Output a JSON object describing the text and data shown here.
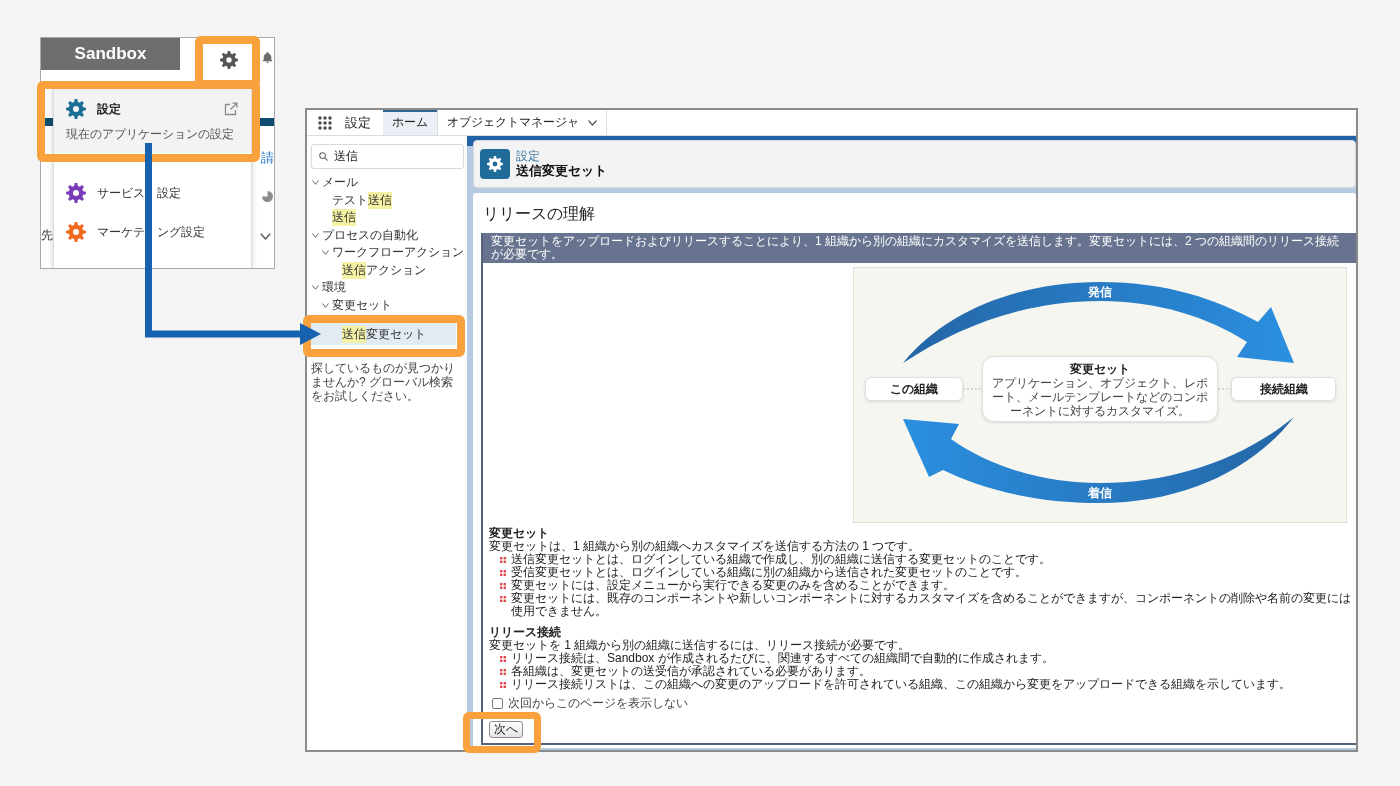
{
  "popup": {
    "sandbox_label": "Sandbox",
    "menu_items": [
      {
        "label_parts": [
          "設定"
        ],
        "subtitle": "現在のアプリケーションの設定",
        "external_link": true,
        "selected": true,
        "color": "#1b6d93"
      },
      {
        "label_parts": [
          "サービス",
          "設定"
        ],
        "external_link": false,
        "selected": false,
        "color": "#7a3bb8"
      },
      {
        "label_parts": [
          "マーケテ",
          "ング設定"
        ],
        "external_link": false,
        "selected": false,
        "color": "#f0691f"
      }
    ],
    "page_behind": {
      "link_fragment": "請",
      "label_fragment": "先"
    }
  },
  "main_window": {
    "app_name": "設定",
    "tabs": [
      {
        "label": "ホーム",
        "selected": true,
        "has_menu": false
      },
      {
        "label": "オブジェクトマネージャ",
        "selected": false,
        "has_menu": true
      }
    ],
    "sidebar": {
      "search": {
        "value": "送信"
      },
      "tree": [
        {
          "segments": [
            {
              "text": "メール",
              "highlight": false
            }
          ],
          "selected": false,
          "expanded": true,
          "children": [
            {
              "segments": [
                {
                  "text": "テスト",
                  "highlight": false
                },
                {
                  "text": "送信",
                  "highlight": true
                }
              ],
              "selected": false
            },
            {
              "segments": [
                {
                  "text": "送信",
                  "highlight": true
                }
              ],
              "selected": false
            }
          ]
        },
        {
          "segments": [
            {
              "text": "プロセスの自動化",
              "highlight": false
            }
          ],
          "selected": false,
          "expanded": true,
          "children": [
            {
              "segments": [
                {
                  "text": "ワークフローアクション",
                  "highlight": false
                }
              ],
              "selected": false,
              "expanded": true,
              "children": [
                {
                  "segments": [
                    {
                      "text": "送信",
                      "highlight": true
                    },
                    {
                      "text": "アクション",
                      "highlight": false
                    }
                  ],
                  "selected": false
                }
              ]
            }
          ]
        },
        {
          "segments": [
            {
              "text": "環境",
              "highlight": false
            }
          ],
          "selected": false,
          "expanded": true,
          "children": [
            {
              "segments": [
                {
                  "text": "変更セット",
                  "highlight": false
                }
              ],
              "selected": false,
              "expanded": true,
              "children": [
                {
                  "segments": [
                    {
                      "text": "送信",
                      "highlight": true
                    },
                    {
                      "text": "変更セット",
                      "highlight": false
                    }
                  ],
                  "selected": true
                }
              ]
            }
          ]
        }
      ],
      "not_found_message": "探しているものが見つかりませんか? グローバル検索をお試しください。"
    },
    "header": {
      "breadcrumb": "設定",
      "title": "送信変更セット"
    },
    "content": {
      "title": "リリースの理解",
      "banner": "変更セットをアップロードおよびリリースすることにより、1 組織から別の組織にカスタマイズを送信します。変更セットには、2 つの組織間のリリース接続が必要です。",
      "diagram": {
        "outgoing_label": "発信",
        "incoming_label": "着信",
        "source_org": "この組織",
        "change_set_title": "変更セット",
        "change_set_description": "アプリケーション、オブジェクト、レポート、メールテンプレートなどのコンポーネントに対するカスタマイズ。",
        "target_org": "接続組織"
      },
      "sections": [
        {
          "heading": "変更セット",
          "intro": "変更セットは、1 組織から別の組織へカスタマイズを送信する方法の 1 つです。",
          "bullets": [
            "送信変更セットとは、ログインしている組織で作成し、別の組織に送信する変更セットのことです。",
            "受信変更セットとは、ログインしている組織に別の組織から送信された変更セットのことです。",
            "変更セットには、設定メニューから実行できる変更のみを含めることができます。",
            "変更セットには、既存のコンポーネントや新しいコンポーネントに対するカスタマイズを含めることができますが、コンポーネントの削除や名前の変更には使用できません。"
          ]
        },
        {
          "heading": "リリース接続",
          "intro": "変更セットを 1 組織から別の組織に送信するには、リリース接続が必要です。",
          "bullets": [
            "リリース接続は、Sandbox が作成されるたびに、関連するすべての組織間で自動的に作成されます。",
            "各組織は、変更セットの送受信が承認されている必要があります。",
            "リリース接続リストは、この組織への変更のアップロードを許可されている組織、この組織から変更をアップロードできる組織を示しています。"
          ]
        }
      ],
      "dont_show_again": {
        "label": "次回からこのページを表示しない",
        "checked": false
      },
      "next_button": "次へ"
    }
  }
}
